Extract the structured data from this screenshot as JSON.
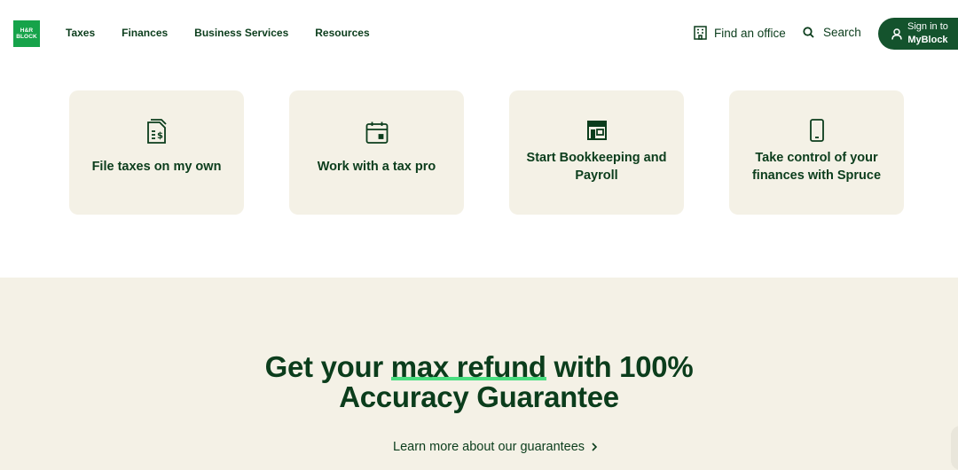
{
  "header": {
    "logo_lines": [
      "H&R",
      "BLOCK"
    ],
    "nav": [
      {
        "label": "Taxes"
      },
      {
        "label": "Finances"
      },
      {
        "label": "Business Services"
      },
      {
        "label": "Resources"
      }
    ],
    "find_office_label": "Find an office",
    "search_label": "Search",
    "signin_line1": "Sign in to",
    "signin_line2": "MyBlock"
  },
  "cards": [
    {
      "label": "File taxes on my own",
      "icon": "tax-document-icon"
    },
    {
      "label": "Work with a tax pro",
      "icon": "calendar-icon"
    },
    {
      "label": "Start Bookkeeping and Payroll",
      "icon": "storefront-icon"
    },
    {
      "label": "Take control of your finances with Spruce",
      "icon": "mobile-phone-icon"
    }
  ],
  "guarantee": {
    "headline_pre": "Get your ",
    "headline_highlight": "max refund",
    "headline_post": " with 100%",
    "headline_line2": "Accuracy Guarantee",
    "link_label": "Learn more about our guarantees"
  },
  "colors": {
    "brand_green": "#16a34a",
    "dark_green": "#14532d",
    "highlight": "#4ade80",
    "cream": "#f4f1e6"
  }
}
